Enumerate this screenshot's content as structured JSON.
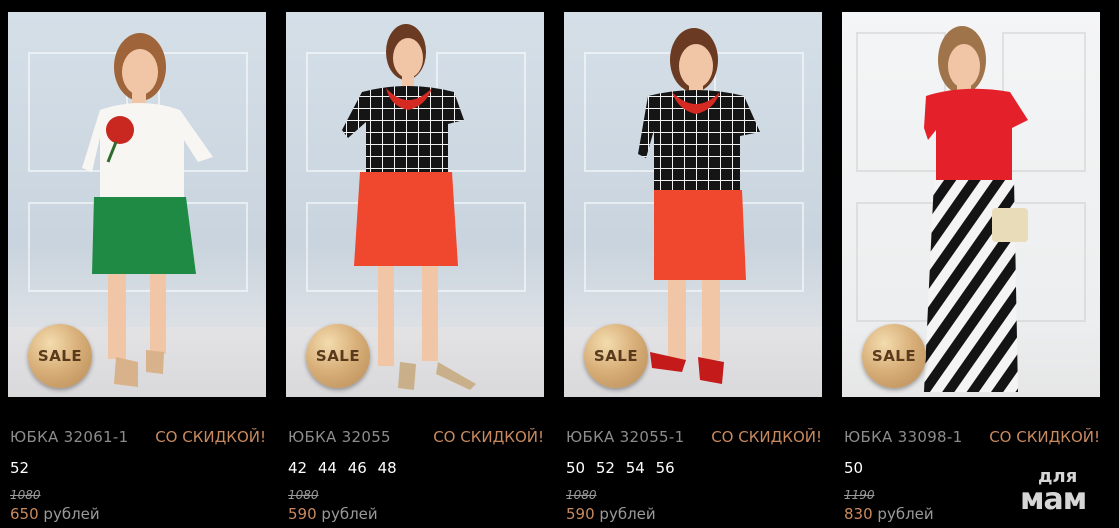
{
  "products": [
    {
      "name": "ЮБКА 32061-1",
      "discount": "СО СКИДКОЙ!",
      "sizes": "52",
      "old_price": "1080",
      "price": "650",
      "currency": "рублей",
      "badge": "SALE"
    },
    {
      "name": "ЮБКА 32055",
      "discount": "СО СКИДКОЙ!",
      "sizes": "42 44 46 48",
      "old_price": "1080",
      "price": "590",
      "currency": "рублей",
      "badge": "SALE"
    },
    {
      "name": "ЮБКА 32055-1",
      "discount": "СО СКИДКОЙ!",
      "sizes": "50 52 54 56",
      "old_price": "1080",
      "price": "590",
      "currency": "рублей",
      "badge": "SALE"
    },
    {
      "name": "ЮБКА 33098-1",
      "discount": "СО СКИДКОЙ!",
      "sizes": "50",
      "old_price": "1190",
      "price": "830",
      "currency": "рублей",
      "badge": "SALE"
    }
  ],
  "watermark": {
    "top": "для",
    "bottom": "мам"
  },
  "colors": {
    "accent": "#c98a5f",
    "background": "#000000",
    "name_text": "#8c8c8c"
  }
}
